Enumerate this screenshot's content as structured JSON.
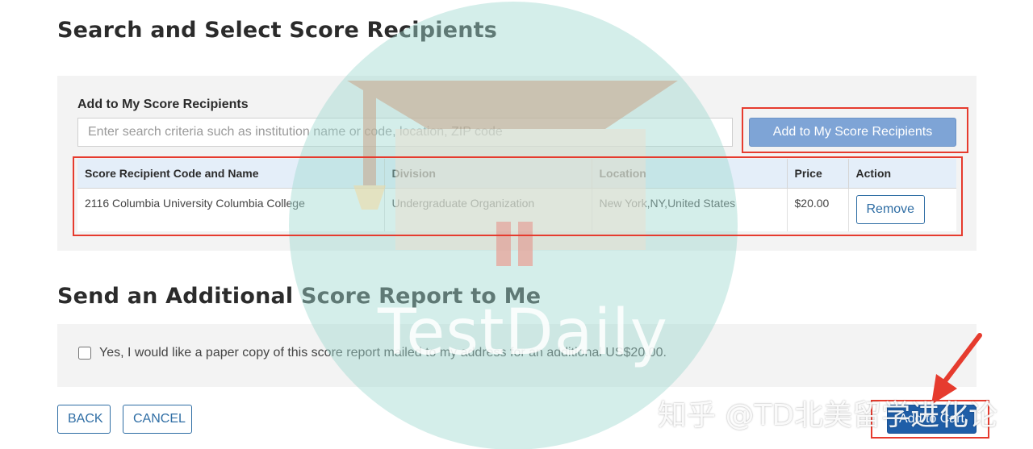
{
  "sections": {
    "search_title": "Search and Select Score Recipients",
    "additional_title": "Send an Additional Score Report to Me"
  },
  "search": {
    "label": "Add to My Score Recipients",
    "placeholder": "Enter search criteria such as institution name or code, location, ZIP code",
    "value": "",
    "add_button": "Add to My Score Recipients"
  },
  "table": {
    "headers": [
      "Score Recipient Code and Name",
      "Division",
      "Location",
      "Price",
      "Action"
    ],
    "rows": [
      {
        "code_name": "2116 Columbia University Columbia College",
        "division": "Undergraduate Organization",
        "location": "New York,NY,United States",
        "price": "$20.00",
        "action": "Remove"
      }
    ]
  },
  "additional": {
    "checkbox_label": "Yes, I would like a paper copy of this score report mailed to my address for an additional US$20.00.",
    "checked": false
  },
  "footer": {
    "back": "BACK",
    "cancel": "CANCEL",
    "add_to_cart": "Add to Cart"
  },
  "watermarks": {
    "logo_text": "TestDaily",
    "zh_text": "知乎 @TD北美留学进化论"
  },
  "colors": {
    "primary": "#1f5ea8",
    "add_button": "#7ea4d6",
    "header_bg": "#e4eef9",
    "panel_bg": "#f3f3f3",
    "highlight": "#e63b2e",
    "watermark": "#a0dad0"
  }
}
